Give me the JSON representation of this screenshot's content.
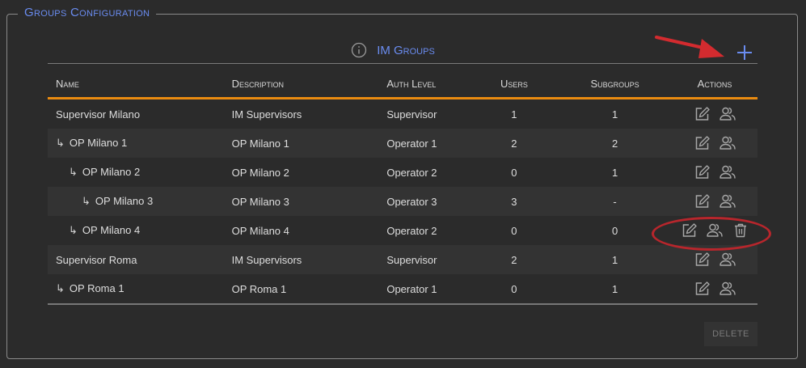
{
  "panel": {
    "legend": "Groups Configuration"
  },
  "table": {
    "title": "IM Groups",
    "columns": [
      "Name",
      "Description",
      "Auth Level",
      "Users",
      "Subgroups",
      "Actions"
    ],
    "rows": [
      {
        "name": "Supervisor Milano",
        "indent": 0,
        "description": "IM Supervisors",
        "auth_level": "Supervisor",
        "users": "1",
        "subgroups": "1",
        "delete": false
      },
      {
        "name": "OP Milano 1",
        "indent": 1,
        "description": "OP Milano 1",
        "auth_level": "Operator 1",
        "users": "2",
        "subgroups": "2",
        "delete": false
      },
      {
        "name": "OP Milano 2",
        "indent": 2,
        "description": "OP Milano 2",
        "auth_level": "Operator 2",
        "users": "0",
        "subgroups": "1",
        "delete": false
      },
      {
        "name": "OP Milano 3",
        "indent": 3,
        "description": "OP Milano 3",
        "auth_level": "Operator 3",
        "users": "3",
        "subgroups": "-",
        "delete": false
      },
      {
        "name": "OP Milano 4",
        "indent": 2,
        "description": "OP Milano 4",
        "auth_level": "Operator 2",
        "users": "0",
        "subgroups": "0",
        "delete": true
      },
      {
        "name": "Supervisor Roma",
        "indent": 0,
        "description": "IM Supervisors",
        "auth_level": "Supervisor",
        "users": "2",
        "subgroups": "1",
        "delete": false
      },
      {
        "name": "OP Roma 1",
        "indent": 1,
        "description": "OP Roma 1",
        "auth_level": "Operator 1",
        "users": "0",
        "subgroups": "1",
        "delete": false
      }
    ]
  },
  "buttons": {
    "delete_label": "DELETE"
  },
  "icons": {
    "info": "info-icon",
    "add": "plus-icon",
    "edit": "edit-icon",
    "users": "users-icon",
    "delete": "trash-icon",
    "indent": "↳"
  },
  "colors": {
    "accent": "#6a8cf0",
    "header_rule": "#e98b10",
    "annotation": "#b8262c"
  }
}
